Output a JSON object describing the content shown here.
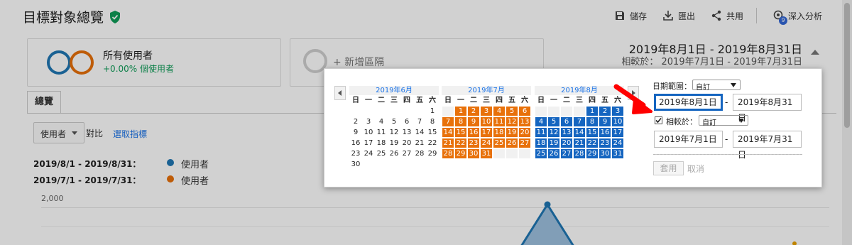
{
  "header": {
    "title": "目標對象總覽",
    "actions": {
      "save": "儲存",
      "export": "匯出",
      "share": "共用",
      "insights": "深入分析",
      "insights_badge": "9"
    }
  },
  "segments": {
    "primary_name": "所有使用者",
    "primary_pct": "+0.00% 個使用者",
    "add_label": "+ 新增區隔"
  },
  "date_range": {
    "main": "2019年8月1日 - 2019年8月31日",
    "compare": "相較於： 2019年7月1日 - 2019年7月31日"
  },
  "tabs": {
    "overview": "總覽"
  },
  "metric": {
    "selected": "使用者",
    "vs": "對比",
    "choose": "選取指標"
  },
  "legend": {
    "row1_range": "2019/8/1 - 2019/8/31：",
    "row2_range": "2019/7/1 - 2019/7/31：",
    "series1": "使用者",
    "series2": "使用者"
  },
  "chart": {
    "y_tick": "2,000"
  },
  "calendar": {
    "weekdays": [
      "日",
      "一",
      "二",
      "三",
      "四",
      "五",
      "六"
    ],
    "months": [
      {
        "title": "2019年6月",
        "offset": 6,
        "days": 30
      },
      {
        "title": "2019年7月",
        "offset": 1,
        "days": 31
      },
      {
        "title": "2019年8月",
        "offset": 4,
        "days": 31
      }
    ]
  },
  "picker": {
    "range_label": "日期範圍：",
    "range_option": "自訂",
    "start": "2019年8月1日",
    "end": "2019年8月31日",
    "compare_label": "相較於：",
    "compare_option": "自訂",
    "compare_start": "2019年7月1日",
    "compare_end": "2019年7月31日",
    "dash": "-",
    "apply": "套用",
    "cancel": "取消"
  },
  "colors": {
    "accent_blue": "#1565c0",
    "accent_orange": "#e8710a",
    "link_blue": "#1a73e8",
    "positive_green": "#0f9d58"
  }
}
